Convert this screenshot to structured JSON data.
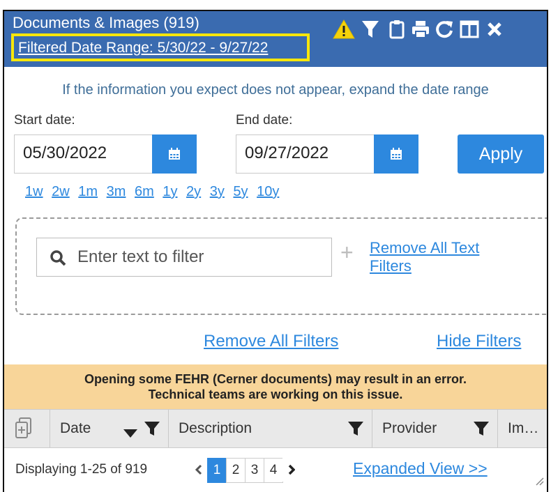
{
  "header": {
    "title": "Documents & Images (919)",
    "date_range_link": "Filtered Date Range: 5/30/22 - 9/27/22",
    "icons": [
      "warning-icon",
      "filter-icon",
      "clipboard-icon",
      "print-icon",
      "refresh-icon",
      "columns-icon",
      "close-icon"
    ]
  },
  "filters": {
    "intro": "If the information you expect does not appear, expand the date range",
    "start_label": "Start date:",
    "start_value": "05/30/2022",
    "end_label": "End date:",
    "end_value": "09/27/2022",
    "apply_label": "Apply",
    "quick_ranges": [
      "1w",
      "2w",
      "1m",
      "3m",
      "6m",
      "1y",
      "2y",
      "3y",
      "5y",
      "10y"
    ],
    "text_filter_placeholder": "Enter text to filter",
    "add_symbol": "+",
    "remove_text_filters": "Remove All Text Filters",
    "remove_all_filters": "Remove All Filters",
    "hide_filters": "Hide Filters"
  },
  "banner": {
    "line1": "Opening some FEHR (Cerner documents) may result in an error.",
    "line2": "Technical teams are working on this issue."
  },
  "table": {
    "columns": [
      "Date",
      "Description",
      "Provider",
      "Im…"
    ]
  },
  "footer": {
    "display_text": "Displaying 1-25 of 919",
    "pages": [
      "1",
      "2",
      "3",
      "4"
    ],
    "active_page": "1",
    "expanded_view": "Expanded View >>"
  },
  "colors": {
    "header_bg": "#3a6bb0",
    "accent": "#2d88de",
    "highlight": "#f7e60b",
    "banner_bg": "#f8d599",
    "warning": "#f5d20a"
  }
}
